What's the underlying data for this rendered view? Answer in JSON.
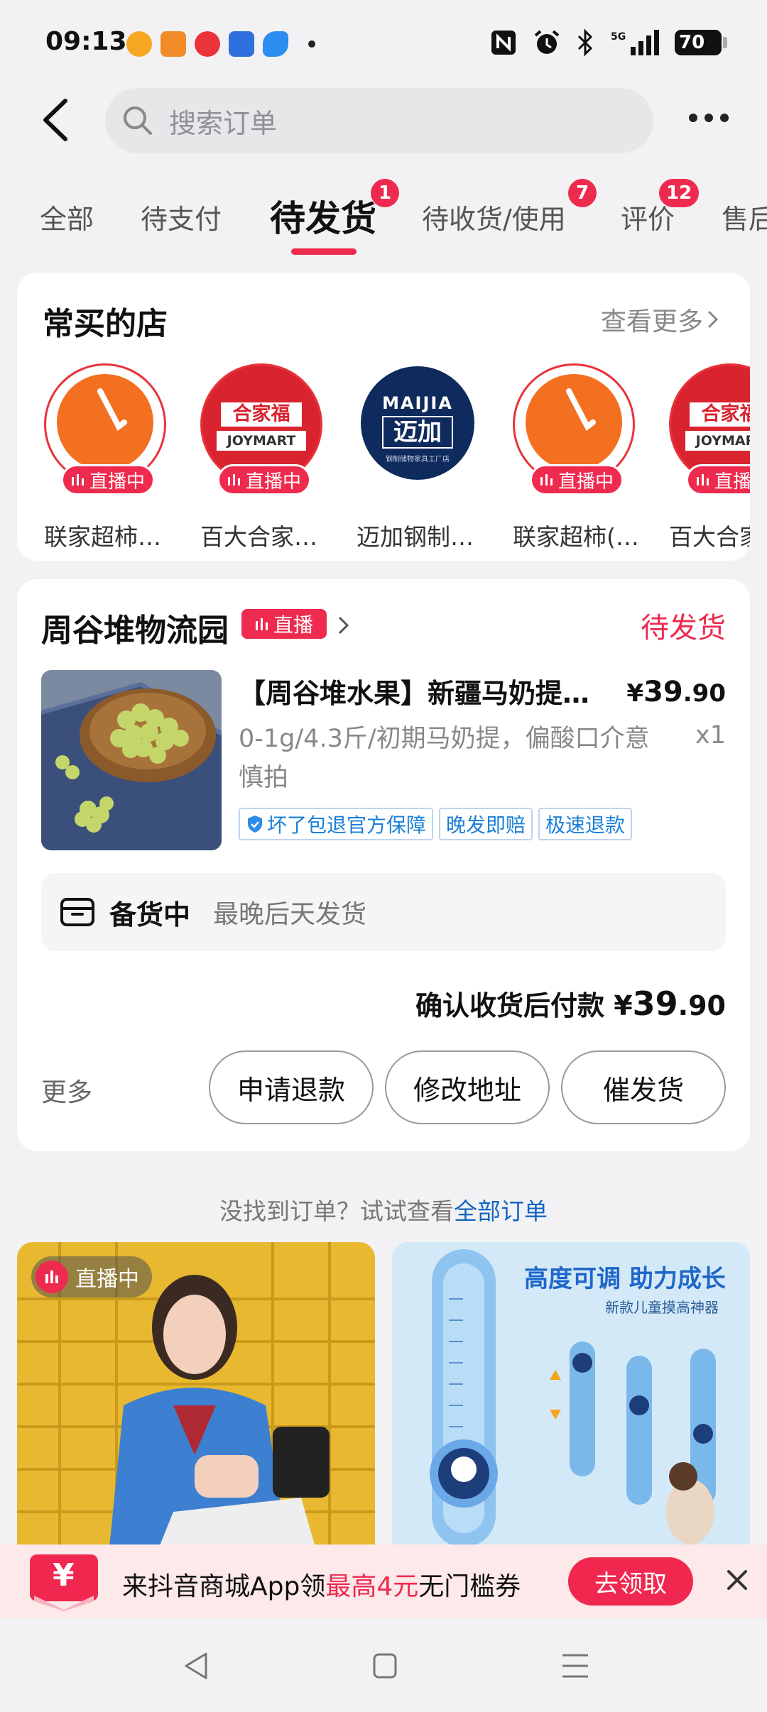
{
  "status_bar": {
    "time": "09:13",
    "battery": "70",
    "network": "5G"
  },
  "header": {
    "search_placeholder": "搜索订单"
  },
  "tabs": [
    {
      "label": "全部",
      "badge": ""
    },
    {
      "label": "待支付",
      "badge": ""
    },
    {
      "label": "待发货",
      "badge": "1"
    },
    {
      "label": "待收货/使用",
      "badge": "7"
    },
    {
      "label": "评价",
      "badge": "12"
    },
    {
      "label": "售后",
      "badge": ""
    }
  ],
  "frequent_shops": {
    "title": "常买的店",
    "more": "查看更多",
    "live_label": "直播中",
    "shops": [
      {
        "name": "联家超柿…",
        "live": true
      },
      {
        "name": "百大合家…",
        "live": true
      },
      {
        "name": "迈加钢制…",
        "live": false
      },
      {
        "name": "联家超柿(…",
        "live": true
      },
      {
        "name": "百大合家",
        "live": true
      }
    ],
    "logos": {
      "joymart_cn": "合家福",
      "joymart_en": "JOYMART",
      "maijia_en": "MAIJIA",
      "maijia_cn": "迈加",
      "maijia_sub": "钢制储物家具工厂店"
    }
  },
  "order": {
    "store_name": "周谷堆物流园",
    "store_live_tag": "直播",
    "status": "待发货",
    "product_title": "【周谷堆水果】新疆马奶提…",
    "price_symbol": "¥",
    "price_int": "39",
    "price_dec": ".90",
    "spec": "0-1g/4.3斤/初期马奶提，偏酸口介意慎拍",
    "quantity": "x1",
    "tags": [
      "坏了包退官方保障",
      "晚发即赔",
      "极速退款"
    ],
    "shipping_label": "备货中",
    "shipping_text": "最晚后天发货",
    "pay_label": "确认收货后付款",
    "pay_symbol": "¥",
    "pay_int": "39",
    "pay_dec": ".90",
    "more": "更多",
    "buttons": [
      "申请退款",
      "修改地址",
      "催发货"
    ]
  },
  "hint": {
    "text": "没找到订单？试试查看",
    "link": "全部订单"
  },
  "recommendations": {
    "live_label": "直播中",
    "right_headline": "高度可调 助力成长",
    "right_sub": "新款儿童摸高神器"
  },
  "coupon_banner": {
    "icon_text": "¥",
    "text_before": "来抖音商城App领",
    "text_highlight": "最高4元",
    "text_after": "无门槛券",
    "button": "去领取"
  },
  "colors": {
    "accent": "#ee2a4e",
    "link": "#1565c0",
    "tag_blue": "#1a7fd8"
  }
}
